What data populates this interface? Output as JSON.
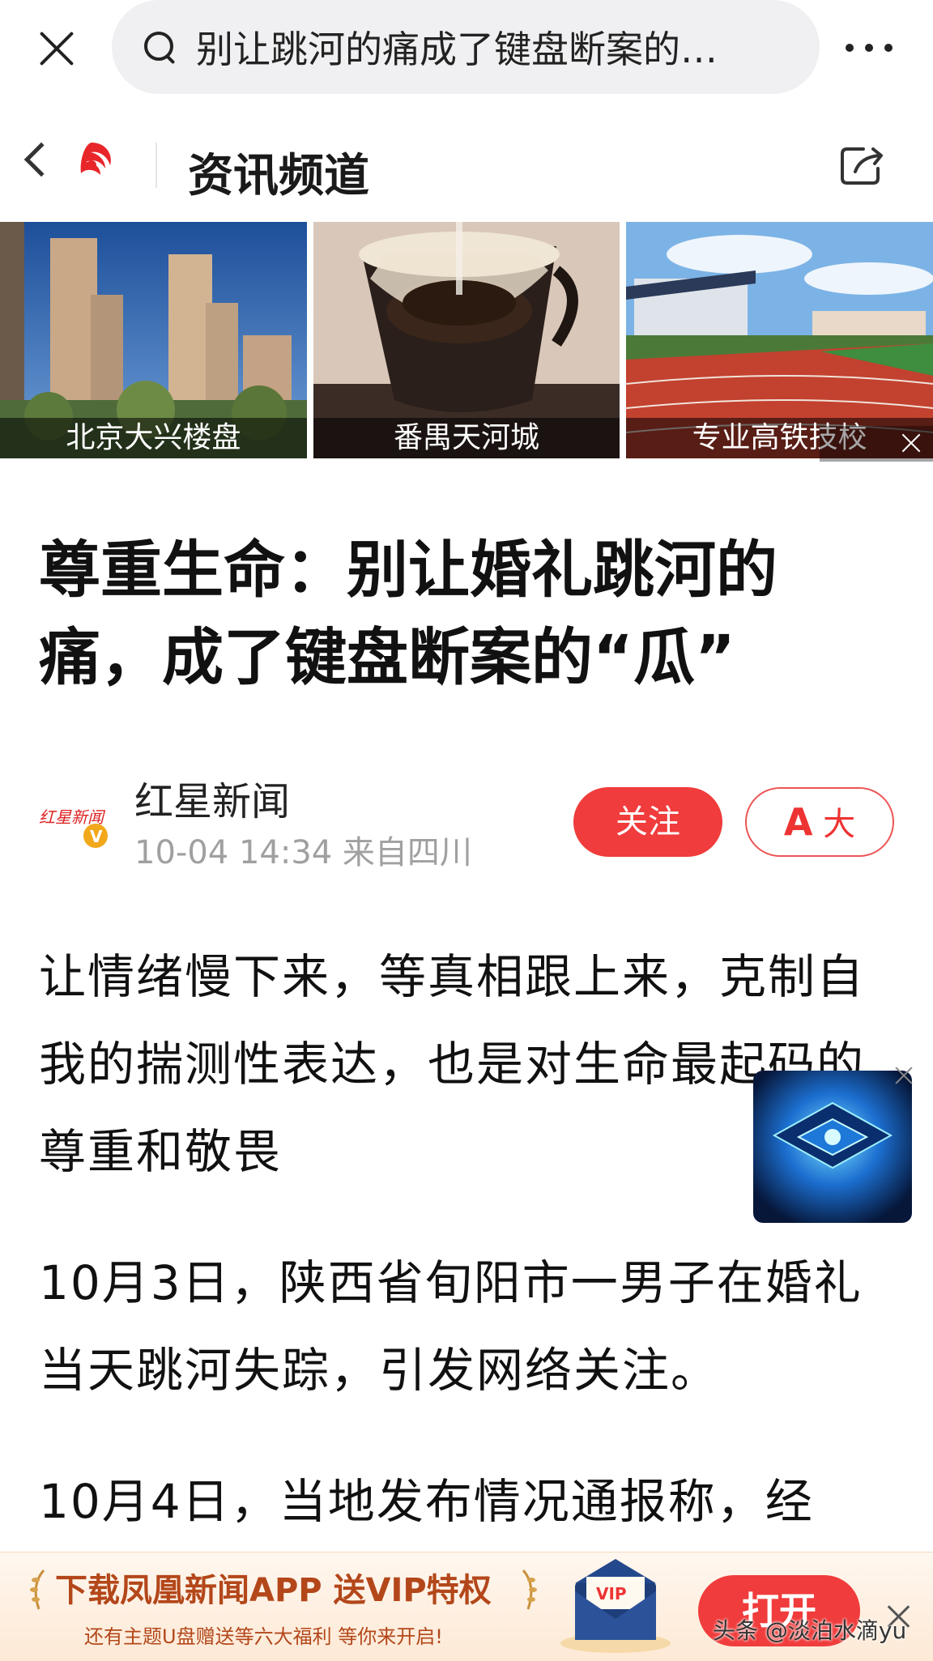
{
  "search": {
    "query": "别让跳河的痛成了键盘断案的…"
  },
  "channel": {
    "title": "资讯频道"
  },
  "banners": [
    {
      "caption": "北京大兴楼盘"
    },
    {
      "caption": "番禺天河城"
    },
    {
      "caption": "专业高铁技校"
    }
  ],
  "article": {
    "title": "尊重生命：别让婚礼跳河的痛，成了键盘断案的“瓜”",
    "paragraphs": [
      "让情绪慢下来，等真相跟上来，克制自我的揣测性表达，也是对生命最起码的尊重和敬畏",
      "10月3日，陕西省旬阳市一男子在婚礼当天跳河失踪，引发网络关注。",
      "10月4日，当地发布情况通报称，经"
    ]
  },
  "author": {
    "name": "红星新闻",
    "meta": "10-04 14:34 来自四川",
    "follow_label": "关注",
    "font_label_a": "A",
    "font_label_big": "大"
  },
  "bottom_ad": {
    "title": "下载凤凰新闻APP 送VIP特权",
    "subtitle": "还有主题U盘赠送等六大福利  等你来开启!",
    "open_label": "打开",
    "watermark": "头条 @淡泊水滴yu"
  },
  "colors": {
    "accent": "#f03c3c",
    "ad_text": "#b3471a"
  }
}
